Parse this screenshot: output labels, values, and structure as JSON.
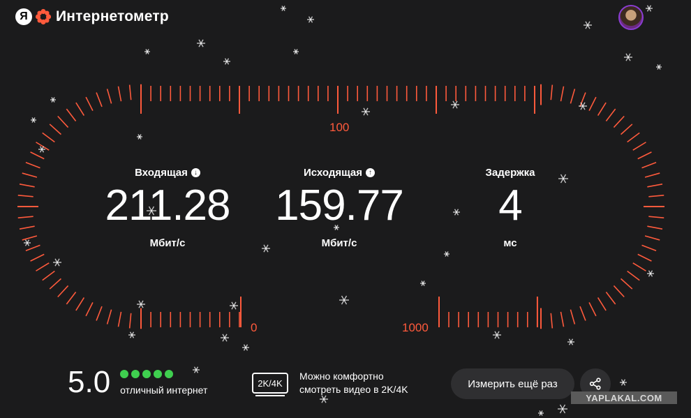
{
  "app": {
    "logo_letter": "Я",
    "title": "Интернетометр"
  },
  "scale": {
    "mid_label": "100",
    "low_label": "0",
    "high_label": "1000"
  },
  "metrics": {
    "download": {
      "label": "Входящая",
      "value": "211.28",
      "unit": "Мбит/с",
      "icon": "arrow-down-icon"
    },
    "upload": {
      "label": "Исходящая",
      "value": "159.77",
      "unit": "Мбит/с",
      "icon": "arrow-up-icon"
    },
    "ping": {
      "label": "Задержка",
      "value": "4",
      "unit": "мс"
    }
  },
  "rating": {
    "score": "5.0",
    "stars": 5,
    "description": "отличный интернет"
  },
  "quality": {
    "badge": "2K/4K",
    "line1": "Можно комфортно",
    "line2": "смотреть видео в 2K/4K"
  },
  "actions": {
    "retry_label": "Измерить ещё раз",
    "share_icon": "share-icon"
  },
  "watermark": "YAPLAKAL.COM",
  "colors": {
    "accent": "#ff5a3c",
    "good": "#3fcf4f",
    "background": "#1b1b1c"
  }
}
